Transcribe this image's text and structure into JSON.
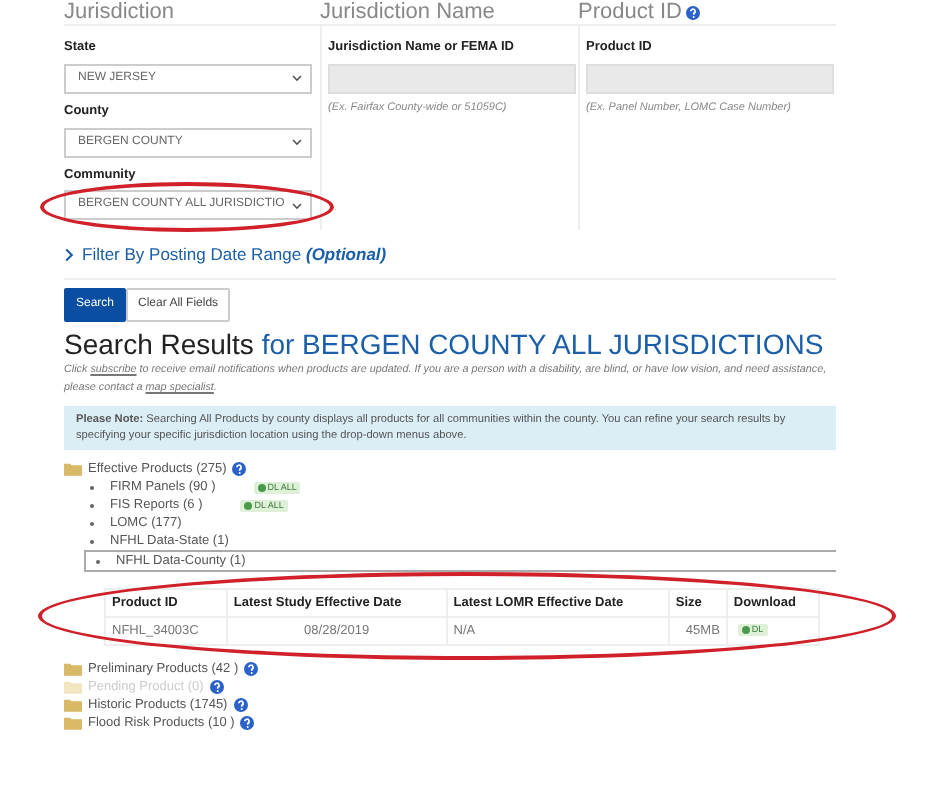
{
  "panels": [
    {
      "heading": "Jurisdiction",
      "help": false
    },
    {
      "heading": "Jurisdiction Name",
      "help": false
    },
    {
      "heading": "Product ID",
      "help": true
    }
  ],
  "jurisdiction": {
    "fields": [
      {
        "label": "State",
        "value": "NEW JERSEY",
        "circled": false
      },
      {
        "label": "County",
        "value": "BERGEN COUNTY",
        "circled": false
      },
      {
        "label": "Community",
        "value": "BERGEN COUNTY ALL JURISDICTIO",
        "circled": true
      }
    ]
  },
  "name_search": {
    "label": "Jurisdiction Name or FEMA ID",
    "hint": "(Ex. Fairfax County-wide or 51059C)"
  },
  "product_search": {
    "label": "Product ID",
    "hint": "(Ex. Panel Number, LOMC Case Number)"
  },
  "filter": {
    "label": "Filter By Posting Date Range",
    "note": "(Optional)",
    "expanded": false
  },
  "buttons": [
    {
      "label": "Search",
      "kind": "primary"
    },
    {
      "label": "Clear All Fields",
      "kind": "secondary"
    }
  ],
  "results": {
    "title": "Search Results",
    "subject": "for BERGEN COUNTY ALL JURISDICTIONS",
    "info": [
      {
        "text": "Click ",
        "link": false
      },
      {
        "text": "subscribe",
        "link": true
      },
      {
        "text": " to receive email notifications when products are updated. If you are a person with a disability, are blind, or have low vision, and need assistance, please contact a ",
        "link": false
      },
      {
        "text": "map specialist",
        "link": true
      },
      {
        "text": ".",
        "link": false
      }
    ],
    "note": "**Please Note:** Searching All Products by county displays all products for all communities within the county. You can refine your search results by specifying your specific jurisdiction location using the drop-down menus above."
  },
  "tree": [
    {
      "label": "Effective Products (275)",
      "help": true,
      "disabled": false,
      "children": [
        {
          "label": "FIRM Panels (90 )",
          "download": "DL ALL",
          "expanded": false
        },
        {
          "label": "FIS Reports (6 )",
          "download": "DL ALL",
          "expanded": false
        },
        {
          "label": "LOMC (177)",
          "expanded": false
        },
        {
          "label": "NFHL Data-State (1)",
          "expanded": false
        },
        {
          "label": "NFHL Data-County (1)",
          "expanded": true,
          "table": {
            "circled": true,
            "columns": [
              "Product ID",
              "Latest Study Effective Date",
              "Latest LOMR Effective Date",
              "Size",
              "Download"
            ],
            "rows": [
              {
                "cells": [
                  "NFHL_34003C",
                  "08/28/2019",
                  "N/A",
                  "45MB"
                ],
                "download": "DL"
              }
            ]
          }
        }
      ]
    },
    {
      "label": "Preliminary Products (42 )",
      "help": true,
      "disabled": false
    },
    {
      "label": "Pending Product (0)",
      "help": true,
      "disabled": true
    },
    {
      "label": "Historic Products (1745)",
      "help": true,
      "disabled": false
    },
    {
      "label": "Flood Risk Products (10 )",
      "help": true,
      "disabled": false
    }
  ]
}
